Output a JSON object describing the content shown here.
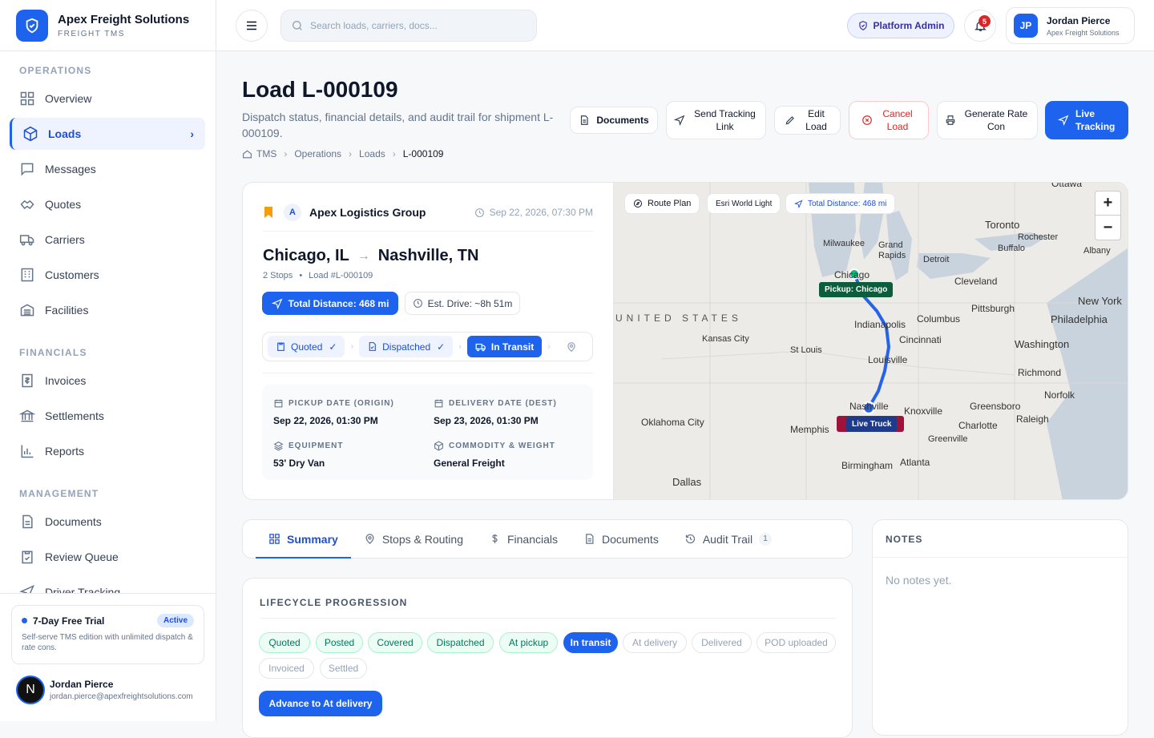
{
  "brand": {
    "name": "Apex Freight Solutions",
    "subtitle": "FREIGHT TMS"
  },
  "sidebar": {
    "sections": [
      {
        "label": "OPERATIONS"
      },
      {
        "label": "FINANCIALS"
      },
      {
        "label": "MANAGEMENT"
      }
    ],
    "items": [
      {
        "label": "Overview",
        "icon": "grid-icon"
      },
      {
        "label": "Loads",
        "icon": "box-icon",
        "active": true
      },
      {
        "label": "Messages",
        "icon": "message-icon"
      },
      {
        "label": "Quotes",
        "icon": "handshake-icon"
      },
      {
        "label": "Carriers",
        "icon": "truck-icon"
      },
      {
        "label": "Customers",
        "icon": "building-icon"
      },
      {
        "label": "Facilities",
        "icon": "warehouse-icon"
      },
      {
        "label": "Invoices",
        "icon": "invoice-icon"
      },
      {
        "label": "Settlements",
        "icon": "bank-icon"
      },
      {
        "label": "Reports",
        "icon": "bar-chart-icon"
      },
      {
        "label": "Documents",
        "icon": "document-icon"
      },
      {
        "label": "Review Queue",
        "icon": "clipboard-check-icon"
      },
      {
        "label": "Driver Tracking",
        "icon": "navigation-icon"
      }
    ],
    "trial": {
      "title": "7-Day Free Trial",
      "badge": "Active",
      "description": "Self-serve TMS edition with unlimited dispatch & rate cons."
    },
    "user": {
      "initial": "N",
      "name": "Jordan Pierce",
      "email": "jordan.pierce@apexfreightsolutions.com"
    }
  },
  "topbar": {
    "search_placeholder": "Search loads, carriers, docs...",
    "admin_label": "Platform Admin",
    "notification_count": "5",
    "profile": {
      "initials": "JP",
      "name": "Jordan Pierce",
      "org": "Apex Freight Solutions"
    }
  },
  "page": {
    "title": "Load L-000109",
    "description": "Dispatch status, financial details, and audit trail for shipment L-000109.",
    "breadcrumb": [
      "TMS",
      "Operations",
      "Loads",
      "L-000109"
    ],
    "actions": {
      "documents": "Documents",
      "send_tracking": "Send Tracking Link",
      "edit": "Edit Load",
      "cancel": "Cancel Load",
      "rate_con": "Generate Rate Con",
      "live": "Live Tracking"
    }
  },
  "load": {
    "carrier_initial": "A",
    "carrier": "Apex Logistics Group",
    "created": "Sep 22, 2026, 07:30 PM",
    "origin": "Chicago, IL",
    "destination": "Nashville, TN",
    "stops": "2 Stops",
    "load_no": "Load #L-000109",
    "distance": "Total Distance: 468 mi",
    "drive": "Est. Drive: ~8h 51m",
    "status_steps": [
      {
        "label": "Quoted",
        "check": "✓"
      },
      {
        "label": "Dispatched",
        "check": "✓"
      },
      {
        "label": "In Transit"
      }
    ],
    "details": {
      "pickup_label": "PICKUP DATE (ORIGIN)",
      "pickup": "Sep 22, 2026, 01:30 PM",
      "delivery_label": "DELIVERY DATE (DEST)",
      "delivery": "Sep 23, 2026, 01:30 PM",
      "equipment_label": "EQUIPMENT",
      "equipment": "53' Dry Van",
      "commodity_label": "COMMODITY & WEIGHT",
      "commodity": "General Freight"
    }
  },
  "map": {
    "route_plan": "Route Plan",
    "basemap": "Esri World Light",
    "distance": "Total Distance: 468 mi",
    "zoom_in": "+",
    "zoom_out": "−",
    "pickup_label": "Pickup: Chicago",
    "truck_label": "Live Truck",
    "cities": {
      "ottawa": "Ottawa",
      "toronto": "Toronto",
      "rochester": "Rochester",
      "buffalo": "Buffalo",
      "albany": "Albany",
      "milwaukee": "Milwaukee",
      "grand_rapids": "Grand Rapids",
      "detroit": "Detroit",
      "chicago": "Chicago",
      "cleveland": "Cleveland",
      "new_york": "New York",
      "pittsburgh": "Pittsburgh",
      "philadelphia": "Philadelphia",
      "united_states": "UNITED STATES",
      "columbus": "Columbus",
      "indianapolis": "Indianapolis",
      "kansas_city": "Kansas City",
      "cincinnati": "Cincinnati",
      "washington": "Washington",
      "st_louis": "St Louis",
      "louisville": "Louisville",
      "richmond": "Richmond",
      "norfolk": "Norfolk",
      "nashville": "Nashville",
      "knoxville": "Knoxville",
      "greensboro": "Greensboro",
      "oklahoma_city": "Oklahoma City",
      "charlotte": "Charlotte",
      "raleigh": "Raleigh",
      "memphis": "Memphis",
      "greenville": "Greenville",
      "atlanta": "Atlanta",
      "birmingham": "Birmingham",
      "dallas": "Dallas"
    }
  },
  "tabs": [
    {
      "label": "Summary",
      "icon": "grid-icon"
    },
    {
      "label": "Stops & Routing",
      "icon": "pin-icon"
    },
    {
      "label": "Financials",
      "icon": "dollar-icon"
    },
    {
      "label": "Documents",
      "icon": "document-icon"
    },
    {
      "label": "Audit Trail",
      "icon": "history-icon",
      "count": "1"
    }
  ],
  "notes": {
    "title": "NOTES",
    "empty": "No notes yet."
  },
  "lifecycle": {
    "title": "LIFECYCLE PROGRESSION",
    "stages": [
      "Quoted",
      "Posted",
      "Covered",
      "Dispatched",
      "At pickup",
      "In transit",
      "At delivery",
      "Delivered",
      "POD uploaded",
      "Invoiced",
      "Settled"
    ],
    "current": "In transit",
    "advance_label": "Advance to At delivery"
  },
  "colors": {
    "accent": "#1d63ed",
    "success": "#047857",
    "danger": "#dc2626",
    "pickup_marker": "#0b5d3b"
  }
}
